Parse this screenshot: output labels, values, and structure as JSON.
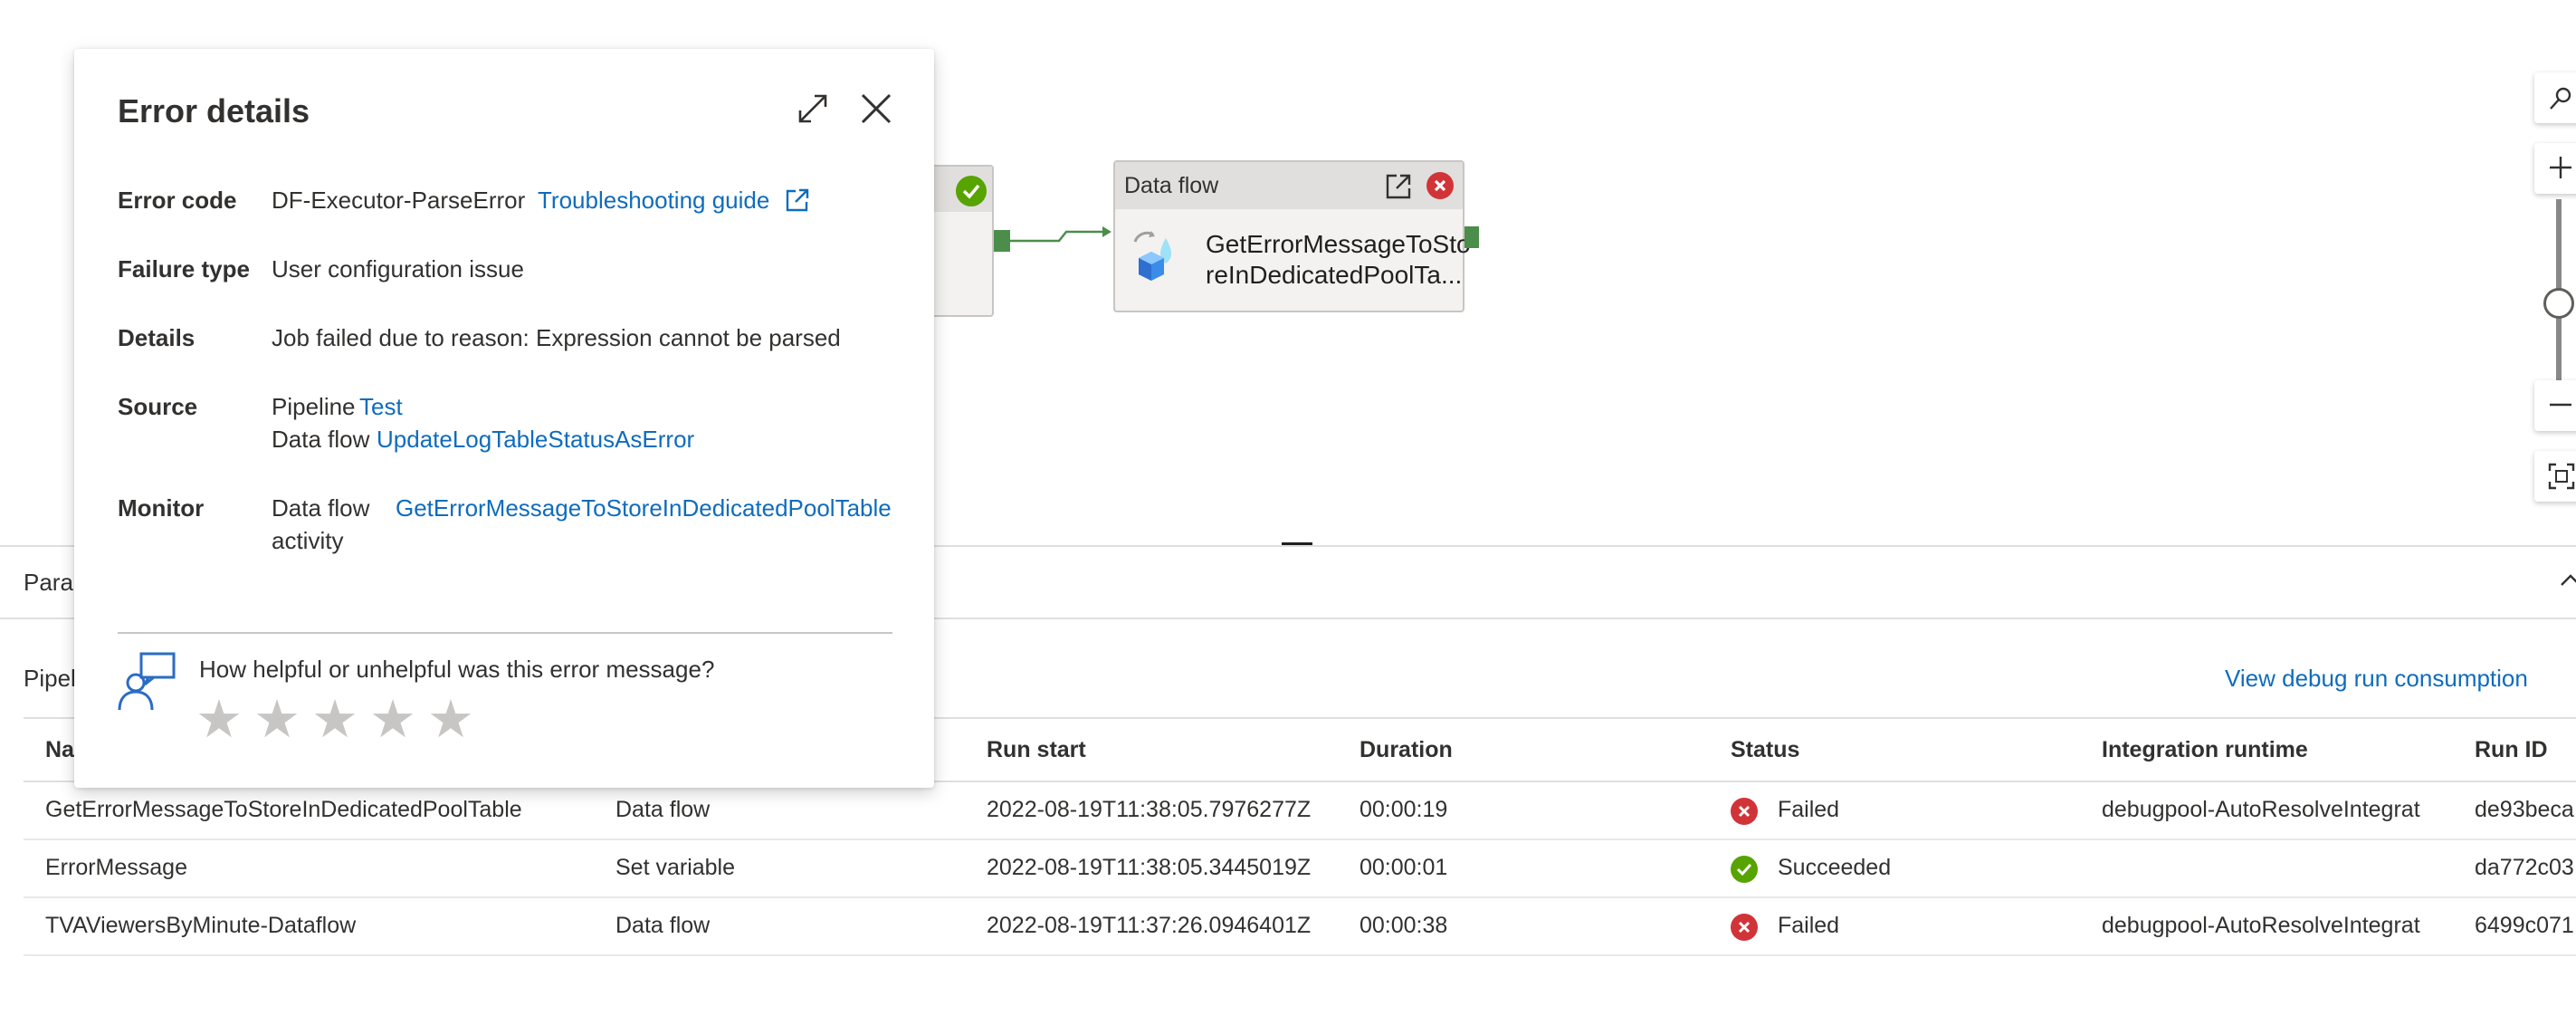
{
  "canvas": {
    "node_dataflow": {
      "type_label": "Data flow",
      "name_line1": "GetErrorMessageToSto",
      "name_line2": "reInDedicatedPoolTa..."
    }
  },
  "zoom_controls": {
    "search_icon": "search-icon",
    "zoom_in_icon": "plus-icon",
    "zoom_out_icon": "minus-icon",
    "fit_icon": "fit-to-screen-icon"
  },
  "panel": {
    "tab_label": "Para",
    "pipeline_label": "Pipel",
    "view_debug_link": "View debug run consumption",
    "columns": {
      "name": "Na",
      "run_start": "Run start",
      "duration": "Duration",
      "status": "Status",
      "integration_runtime": "Integration runtime",
      "run_id": "Run ID"
    },
    "rows": [
      {
        "name": "GetErrorMessageToStoreInDedicatedPoolTable",
        "type": "Data flow",
        "run_start": "2022-08-19T11:38:05.7976277Z",
        "duration": "00:00:19",
        "status": "Failed",
        "runtime": "debugpool-AutoResolveIntegrat",
        "run_id": "de93beca"
      },
      {
        "name": "ErrorMessage",
        "type": "Set variable",
        "run_start": "2022-08-19T11:38:05.3445019Z",
        "duration": "00:00:01",
        "status": "Succeeded",
        "runtime": "",
        "run_id": "da772c03"
      },
      {
        "name": "TVAViewersByMinute-Dataflow",
        "type": "Data flow",
        "run_start": "2022-08-19T11:37:26.0946401Z",
        "duration": "00:00:38",
        "status": "Failed",
        "runtime": "debugpool-AutoResolveIntegrat",
        "run_id": "6499c071"
      }
    ]
  },
  "dialog": {
    "title": "Error details",
    "error_code_label": "Error code",
    "error_code_value": "DF-Executor-ParseError",
    "troubleshooting_link": "Troubleshooting guide",
    "failure_type_label": "Failure type",
    "failure_type_value": "User configuration issue",
    "details_label": "Details",
    "details_value": "Job failed due to reason: Expression cannot be parsed",
    "source_label": "Source",
    "source_pipeline_prefix": "Pipeline",
    "source_pipeline_link": "Test",
    "source_dataflow_prefix": "Data flow",
    "source_dataflow_link": "UpdateLogTableStatusAsError",
    "monitor_label": "Monitor",
    "monitor_prefix_line1": "Data flow",
    "monitor_prefix_line2": "activity",
    "monitor_link": "GetErrorMessageToStoreInDedicatedPoolTable",
    "feedback_question": "How helpful or unhelpful was this error message?",
    "rating_stars": 5,
    "rating_value": 0
  },
  "colors": {
    "link": "#0f6cbd",
    "failed": "#d13438",
    "succeeded": "#57a300",
    "port": "#4b8e4b"
  }
}
